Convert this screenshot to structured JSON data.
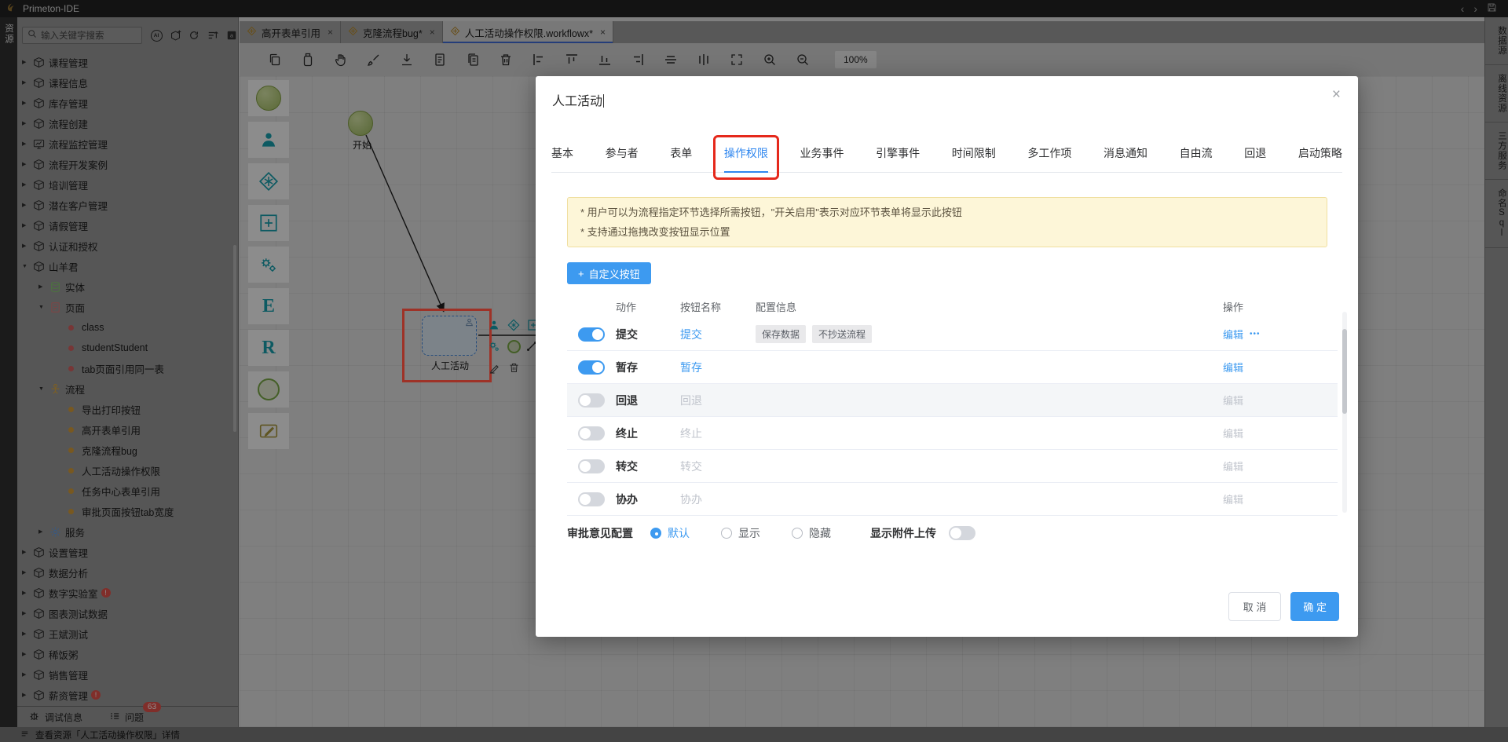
{
  "icons": {
    "close": "×",
    "back": "‹",
    "forward": "›",
    "tab_close": "×",
    "more": "•••",
    "plus": "+",
    "collapsed": "▶",
    "expanded": "▼"
  },
  "colors": {
    "accent_blue": "#3d9af0",
    "tab_active_blue": "#2e86ef",
    "annotation_red": "#e5281b",
    "notice_bg": "#fdf6d8",
    "notice_border": "#f0dfa0",
    "toggle_off": "#d4d7dd",
    "badge_red": "#cf4b44"
  },
  "titlebar": {
    "app_title": "Primeton-IDE"
  },
  "activitybar": {
    "resources_label": "资源"
  },
  "sidebar": {
    "search_placeholder": "输入关键字搜索",
    "tree": [
      {
        "label": "课程管理",
        "level": 1,
        "icon": "box",
        "state": "collapsed"
      },
      {
        "label": "课程信息",
        "level": 1,
        "icon": "box",
        "state": "collapsed"
      },
      {
        "label": "库存管理",
        "level": 1,
        "icon": "box",
        "state": "collapsed"
      },
      {
        "label": "流程创建",
        "level": 1,
        "icon": "box",
        "state": "collapsed"
      },
      {
        "label": "流程监控管理",
        "level": 1,
        "icon": "monitor",
        "state": "collapsed"
      },
      {
        "label": "流程开发案例",
        "level": 1,
        "icon": "box",
        "state": "collapsed"
      },
      {
        "label": "培训管理",
        "level": 1,
        "icon": "box",
        "state": "collapsed"
      },
      {
        "label": "潜在客户管理",
        "level": 1,
        "icon": "box",
        "state": "collapsed"
      },
      {
        "label": "请假管理",
        "level": 1,
        "icon": "box",
        "state": "collapsed"
      },
      {
        "label": "认证和授权",
        "level": 1,
        "icon": "box",
        "state": "collapsed"
      },
      {
        "label": "山羊君",
        "level": 1,
        "icon": "box",
        "state": "expanded"
      },
      {
        "label": "实体",
        "level": 2,
        "icon": "db",
        "state": "collapsed"
      },
      {
        "label": "页面",
        "level": 2,
        "icon": "page",
        "state": "expanded"
      },
      {
        "label": "class",
        "level": 3,
        "icon": "dot-red",
        "state": "leaf"
      },
      {
        "label": "studentStudent",
        "level": 3,
        "icon": "dot-red",
        "state": "leaf"
      },
      {
        "label": "tab页面引用同一表",
        "level": 3,
        "icon": "dot-red",
        "state": "leaf"
      },
      {
        "label": "流程",
        "level": 2,
        "icon": "flow",
        "state": "expanded"
      },
      {
        "label": "导出打印按钮",
        "level": 3,
        "icon": "dot-orange",
        "state": "leaf"
      },
      {
        "label": "高开表单引用",
        "level": 3,
        "icon": "dot-orange",
        "state": "leaf"
      },
      {
        "label": "克隆流程bug",
        "level": 3,
        "icon": "dot-orange",
        "state": "leaf"
      },
      {
        "label": "人工活动操作权限",
        "level": 3,
        "icon": "dot-orange",
        "state": "leaf"
      },
      {
        "label": "任务中心表单引用",
        "level": 3,
        "icon": "dot-orange",
        "state": "leaf"
      },
      {
        "label": "审批页面按钮tab宽度",
        "level": 3,
        "icon": "dot-orange",
        "state": "leaf"
      },
      {
        "label": "服务",
        "level": 2,
        "icon": "gear",
        "state": "collapsed"
      },
      {
        "label": "设置管理",
        "level": 1,
        "icon": "box",
        "state": "collapsed"
      },
      {
        "label": "数据分析",
        "level": 1,
        "icon": "box",
        "state": "collapsed"
      },
      {
        "label": "数字实验室",
        "level": 1,
        "icon": "box",
        "state": "collapsed",
        "badge": true
      },
      {
        "label": "图表测试数据",
        "level": 1,
        "icon": "box",
        "state": "collapsed"
      },
      {
        "label": "王斌测试",
        "level": 1,
        "icon": "box",
        "state": "collapsed"
      },
      {
        "label": "稀饭粥",
        "level": 1,
        "icon": "box",
        "state": "collapsed"
      },
      {
        "label": "销售管理",
        "level": 1,
        "icon": "box",
        "state": "collapsed"
      },
      {
        "label": "薪资管理",
        "level": 1,
        "icon": "box",
        "state": "collapsed",
        "badge": true
      }
    ],
    "debug_label": "调试信息",
    "problems_label": "问题",
    "problems_badge": "63"
  },
  "editor": {
    "tabs": [
      {
        "label": "高开表单引用",
        "active": false
      },
      {
        "label": "克隆流程bug*",
        "active": false
      },
      {
        "label": "人工活动操作权限.workflowx*",
        "active": true
      }
    ],
    "zoom_level": "100%"
  },
  "toolbar": {
    "buttons": [
      "copy",
      "paste",
      "pan",
      "format-brush",
      "export",
      "document",
      "duplicate",
      "delete",
      "align-left",
      "align-top",
      "align-bottom",
      "align-right",
      "align-center",
      "distribute",
      "fullscreen",
      "zoom-in",
      "zoom-out"
    ]
  },
  "palette": [
    {
      "name": "start-event",
      "type": "circle"
    },
    {
      "name": "participant",
      "type": "svg"
    },
    {
      "name": "gateway",
      "type": "svg"
    },
    {
      "name": "subprocess",
      "type": "svg"
    },
    {
      "name": "service",
      "type": "svg"
    },
    {
      "name": "entity",
      "type": "letter",
      "letter": "E"
    },
    {
      "name": "report",
      "type": "letter",
      "letter": "R"
    },
    {
      "name": "end-event",
      "type": "ring"
    },
    {
      "name": "note",
      "type": "svg"
    }
  ],
  "canvas": {
    "start_label": "开始",
    "node_label": "人工活动"
  },
  "rightbar": {
    "items": [
      "数据源",
      "离线资源",
      "三方服务",
      "命名Sql"
    ]
  },
  "statusbar": {
    "text": "查看资源「人工活动操作权限」详情"
  },
  "modal": {
    "title": "人工活动",
    "tabs": [
      "基本",
      "参与者",
      "表单",
      "操作权限",
      "业务事件",
      "引擎事件",
      "时间限制",
      "多工作项",
      "消息通知",
      "自由流",
      "回退",
      "启动策略"
    ],
    "active_tab": "操作权限",
    "notice": [
      "* 用户可以为流程指定环节选择所需按钮，\"开关启用\"表示对应环节表单将显示此按钮",
      "* 支持通过拖拽改变按钮显示位置"
    ],
    "custom_button": {
      "icon": "+",
      "label": "自定义按钮"
    },
    "table": {
      "headers": [
        "动作",
        "按钮名称",
        "配置信息",
        "操作"
      ],
      "edit_label": "编辑",
      "rows": [
        {
          "enabled": true,
          "action": "提交",
          "name": "提交",
          "tags": [
            "保存数据",
            "不抄送流程"
          ],
          "more": true,
          "highlight": false
        },
        {
          "enabled": true,
          "action": "暂存",
          "name": "暂存",
          "tags": [],
          "more": false,
          "highlight": false
        },
        {
          "enabled": false,
          "action": "回退",
          "name": "回退",
          "tags": [],
          "more": false,
          "highlight": true
        },
        {
          "enabled": false,
          "action": "终止",
          "name": "终止",
          "tags": [],
          "more": false,
          "highlight": false
        },
        {
          "enabled": false,
          "action": "转交",
          "name": "转交",
          "tags": [],
          "more": false,
          "highlight": false
        },
        {
          "enabled": false,
          "action": "协办",
          "name": "协办",
          "tags": [],
          "more": false,
          "highlight": false
        }
      ]
    },
    "opinion": {
      "label": "审批意见配置",
      "options": [
        "默认",
        "显示",
        "隐藏"
      ],
      "selected": "默认"
    },
    "attachment": {
      "label": "显示附件上传",
      "enabled": false
    },
    "footer": {
      "cancel": "取 消",
      "ok": "确 定"
    }
  }
}
